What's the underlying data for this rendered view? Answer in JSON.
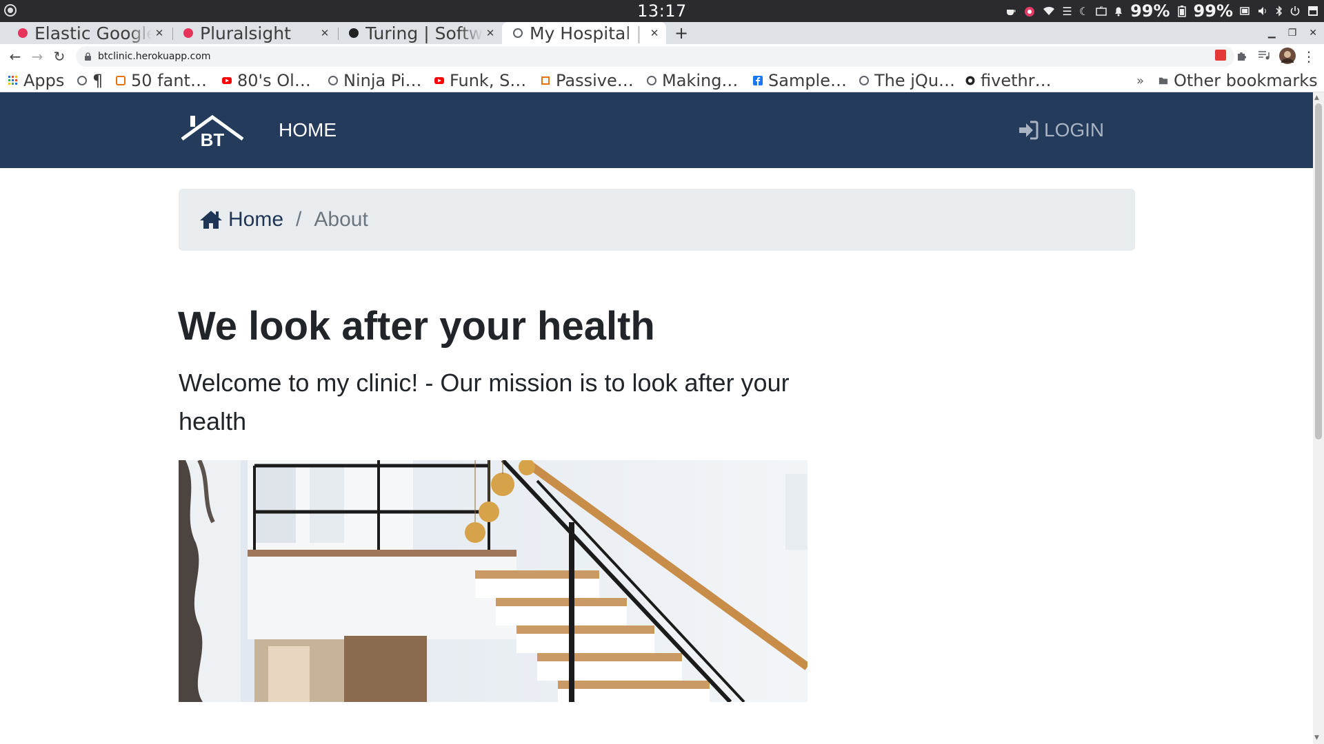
{
  "os": {
    "clock": "13:17",
    "battery_1": "99%",
    "battery_2": "99%"
  },
  "browser": {
    "tabs": [
      {
        "title": "Elastic Google Cloud",
        "favicon_color": "#e8335a",
        "active": false
      },
      {
        "title": "Pluralsight",
        "favicon_color": "#e8335a",
        "active": false
      },
      {
        "title": "Turing | Software",
        "favicon_color": "#222222",
        "active": false
      },
      {
        "title": "My Hospital | Home",
        "favicon_color": "#5f6368",
        "active": true
      }
    ],
    "new_tab_label": "+",
    "url": "btclinic.herokuapp.com",
    "bookmarks": [
      {
        "label": "Apps",
        "icon": "apps-grid-icon"
      },
      {
        "label": "¶",
        "icon": "globe-icon"
      },
      {
        "label": "50 fant…",
        "icon": "square-orange-icon"
      },
      {
        "label": "80's Ol…",
        "icon": "youtube-icon"
      },
      {
        "label": "Ninja Pi…",
        "icon": "globe-icon"
      },
      {
        "label": "Funk, S…",
        "icon": "youtube-icon"
      },
      {
        "label": "Passive…",
        "icon": "chip-icon"
      },
      {
        "label": "Making…",
        "icon": "globe-icon"
      },
      {
        "label": "Sample…",
        "icon": "facebook-icon"
      },
      {
        "label": "The jQu…",
        "icon": "globe-icon"
      },
      {
        "label": "fivethr…",
        "icon": "fox-icon"
      }
    ],
    "bookmarks_more": "»",
    "other_bookmarks": "Other bookmarks"
  },
  "site": {
    "brand_text": "BT",
    "nav": {
      "home": "HOME",
      "login": "LOGIN"
    },
    "colors": {
      "navbar": "#243b5c",
      "breadcrumb_bg": "#e9ecef"
    },
    "breadcrumb": {
      "home": "Home",
      "separator": "/",
      "current": "About"
    },
    "headline": "We look after your health",
    "lead": "Welcome to my clinic! - Our mission is to look after your health"
  }
}
